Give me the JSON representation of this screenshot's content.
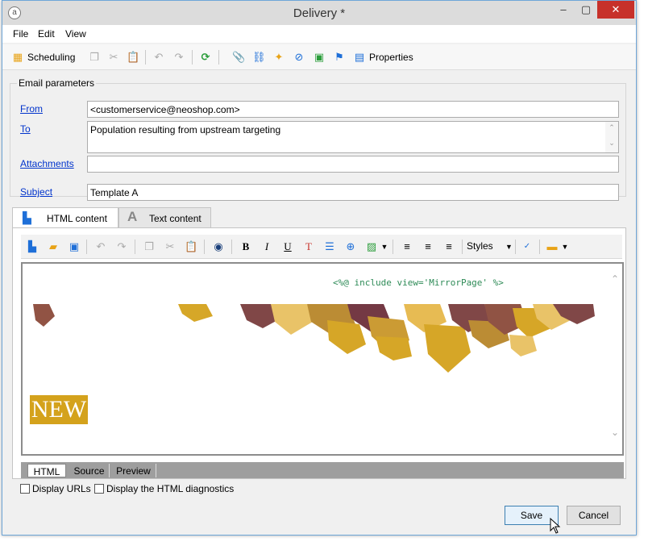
{
  "window": {
    "title": "Delivery *",
    "min": "–",
    "max": "▢",
    "close": "✕"
  },
  "menu": [
    "File",
    "Edit",
    "View"
  ],
  "toolbar": {
    "scheduling": "Scheduling",
    "properties": "Properties"
  },
  "email_params": {
    "legend": "Email parameters",
    "from_label": "From",
    "from_value": "<customerservice@neoshop.com>",
    "to_label": "To",
    "to_value": "Population resulting from upstream targeting",
    "attachments_label": "Attachments",
    "attachments_value": "",
    "subject_label": "Subject",
    "subject_value": "Template A"
  },
  "content_tabs": {
    "html": "HTML content",
    "text": "Text content"
  },
  "editor": {
    "styles_label": "Styles",
    "include_code": "<%@ include view='MirrorPage' %>",
    "new_badge": "NEW"
  },
  "view_tabs": [
    "HTML",
    "Source",
    "Preview"
  ],
  "options": {
    "display_urls": "Display URLs",
    "display_diagnostics": "Display the HTML diagnostics"
  },
  "buttons": {
    "save": "Save",
    "cancel": "Cancel"
  },
  "colors": {
    "close_button": "#c7312a",
    "link": "#0033cc",
    "badge": "#d4a21c"
  }
}
